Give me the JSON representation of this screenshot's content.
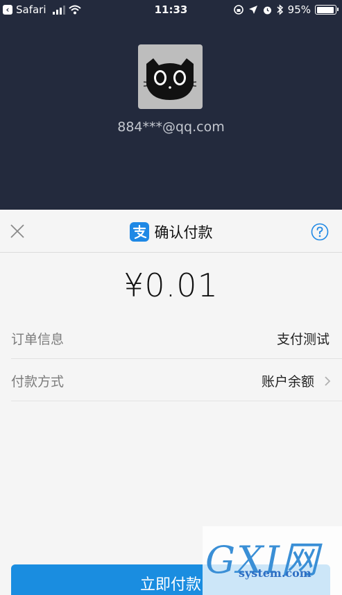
{
  "status_bar": {
    "back_app": "Safari",
    "time": "11:33",
    "battery": "95%",
    "battery_level": 0.95
  },
  "user": {
    "account": "884***@qq.com",
    "avatar_icon": "black-cat-avatar"
  },
  "sheet": {
    "title": "确认付款",
    "amount": "¥0.01",
    "rows": [
      {
        "label": "订单信息",
        "value": "支付测试"
      },
      {
        "label": "付款方式",
        "value": "账户余额"
      }
    ],
    "pay_button": "立即付款"
  },
  "watermark": {
    "brand": "GXI网",
    "site": "system.com"
  },
  "colors": {
    "header_bg": "#232a3d",
    "accent": "#1a8de0",
    "alipay_blue": "#1e88e5"
  }
}
